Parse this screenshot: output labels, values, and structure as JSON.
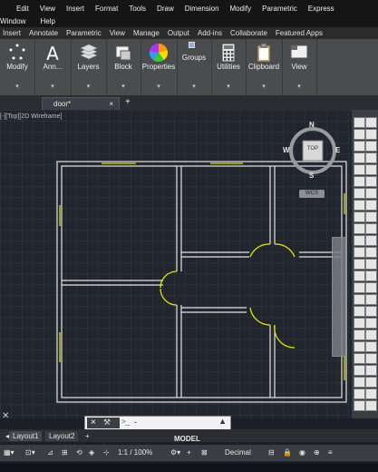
{
  "menu": {
    "row1": [
      "Edit",
      "View",
      "Insert",
      "Format",
      "Tools",
      "Draw",
      "Dimension",
      "Modify",
      "Parametric",
      "Express"
    ],
    "row2": [
      "Window",
      "Help"
    ]
  },
  "ribbon_tabs": [
    "Insert",
    "Annotate",
    "Parametric",
    "View",
    "Manage",
    "Output",
    "Add-ins",
    "Collaborate",
    "Featured Apps"
  ],
  "ribbon_groups": [
    {
      "label": "Modify",
      "icon": "modify-icon"
    },
    {
      "label": "Ann...",
      "icon": "text-icon"
    },
    {
      "label": "Layers",
      "icon": "layers-icon"
    },
    {
      "label": "Block",
      "icon": "block-icon"
    },
    {
      "label": "Properties",
      "icon": "properties-icon"
    },
    {
      "label": "Groups",
      "icon": "groups-icon"
    },
    {
      "label": "Utilities",
      "icon": "calculator-icon"
    },
    {
      "label": "Clipboard",
      "icon": "clipboard-icon"
    },
    {
      "label": "View",
      "icon": "view-icon"
    }
  ],
  "doc_tab": {
    "name": "door*",
    "close": "×",
    "add": "+"
  },
  "viewport_label": "[-][Top][2D Wireframe]",
  "viewcube": {
    "top": "TOP",
    "n": "N",
    "s": "S",
    "e": "E",
    "w": "W",
    "wcs": "WCS"
  },
  "command": {
    "prompt": ">_",
    "value": "-",
    "close": "×"
  },
  "layouts": [
    "Layout1",
    "Layout2"
  ],
  "layout_add": "+",
  "status": {
    "model": "MODEL",
    "scale": "1:1 / 100%",
    "units": "Decimal"
  },
  "colors": {
    "wall": "#e4e4e4",
    "door": "#e0e000"
  }
}
